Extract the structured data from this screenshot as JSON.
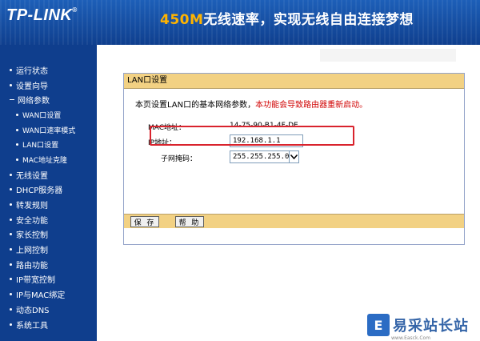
{
  "header": {
    "logo": "TP-LINK",
    "logo_mark": "®",
    "slogan_highlight": "450M",
    "slogan_rest": "无线速率，实现无线自由连接梦想"
  },
  "sidebar": {
    "items": [
      {
        "label": "运行状态",
        "level": 1
      },
      {
        "label": "设置向导",
        "level": 1
      },
      {
        "label": "网络参数",
        "level": 1,
        "expanded": true
      },
      {
        "label": "WAN口设置",
        "level": 2
      },
      {
        "label": "WAN口速率模式",
        "level": 2
      },
      {
        "label": "LAN口设置",
        "level": 2,
        "active": true
      },
      {
        "label": "MAC地址克隆",
        "level": 2
      },
      {
        "label": "无线设置",
        "level": 1
      },
      {
        "label": "DHCP服务器",
        "level": 1
      },
      {
        "label": "转发规则",
        "level": 1
      },
      {
        "label": "安全功能",
        "level": 1
      },
      {
        "label": "家长控制",
        "level": 1
      },
      {
        "label": "上网控制",
        "level": 1
      },
      {
        "label": "路由功能",
        "level": 1
      },
      {
        "label": "IP带宽控制",
        "level": 1
      },
      {
        "label": "IP与MAC绑定",
        "level": 1
      },
      {
        "label": "动态DNS",
        "level": 1
      },
      {
        "label": "系统工具",
        "level": 1
      }
    ]
  },
  "panel": {
    "title": "LAN口设置",
    "intro": "本页设置LAN口的基本网络参数，",
    "warning": "本功能会导致路由器重新启动。",
    "mac_label": "MAC地址：",
    "mac_value": "14-75-90-B1-4F-DE",
    "ip_label": "IP地址：",
    "ip_value": "192.168.1.1",
    "mask_label": "子网掩码：",
    "mask_value": "255.255.255.0",
    "save_label": "保 存",
    "help_label": "帮 助"
  },
  "watermark": {
    "icon": "E",
    "text": "易采站长站",
    "url": "www.Easck.Com"
  },
  "colors": {
    "sidebar_bg": "#0f3e8d",
    "panel_bar": "#f2d183",
    "warning": "#d00000",
    "highlight_box": "#d9232d"
  }
}
